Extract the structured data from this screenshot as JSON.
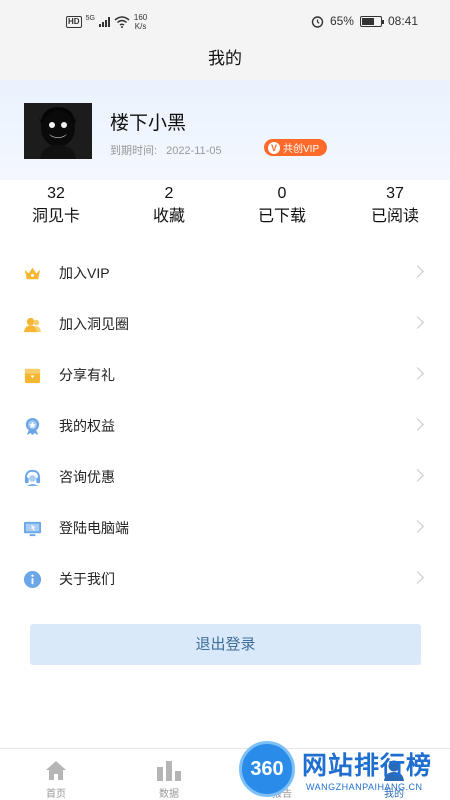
{
  "status_bar": {
    "hd": "HD",
    "network": "5G",
    "speed_value": "160",
    "speed_unit": "K/s",
    "battery": "65%",
    "battery_level": 0.65,
    "time": "08:41"
  },
  "header": {
    "title": "我的"
  },
  "profile": {
    "username": "楼下小黑",
    "expiry_label": "到期时间:",
    "expiry_date": "2022-11-05",
    "vip_icon": "V",
    "vip_label": "共创VIP"
  },
  "stats": [
    {
      "value": "32",
      "label": "洞见卡"
    },
    {
      "value": "2",
      "label": "收藏"
    },
    {
      "value": "0",
      "label": "已下载"
    },
    {
      "value": "37",
      "label": "已阅读"
    }
  ],
  "menu": [
    {
      "label": "加入VIP",
      "icon": "crown-icon",
      "color": "#f5b731"
    },
    {
      "label": "加入洞见圈",
      "icon": "people-icon",
      "color": "#f5b731"
    },
    {
      "label": "分享有礼",
      "icon": "gift-icon",
      "color": "#f5b731"
    },
    {
      "label": "我的权益",
      "icon": "medal-icon",
      "color": "#6aa6e8"
    },
    {
      "label": "咨询优惠",
      "icon": "headset-icon",
      "color": "#6aa6e8"
    },
    {
      "label": "登陆电脑端",
      "icon": "monitor-icon",
      "color": "#6aa6e8"
    },
    {
      "label": "关于我们",
      "icon": "info-icon",
      "color": "#6aa6e8"
    }
  ],
  "logout_label": "退出登录",
  "tabs": [
    {
      "label": "首页",
      "icon": "home-icon"
    },
    {
      "label": "数据",
      "icon": "chart-icon"
    },
    {
      "label": "报告",
      "icon": "report-icon"
    },
    {
      "label": "我的",
      "icon": "user-icon"
    }
  ],
  "watermark": {
    "badge": "360",
    "text": "网站排行榜",
    "url": "WANGZHANPAIHANG.CN"
  },
  "colors": {
    "accent": "#3f6e9b",
    "vip_badge": "#ff6a2b",
    "logout_bg": "#d9e9fa"
  }
}
